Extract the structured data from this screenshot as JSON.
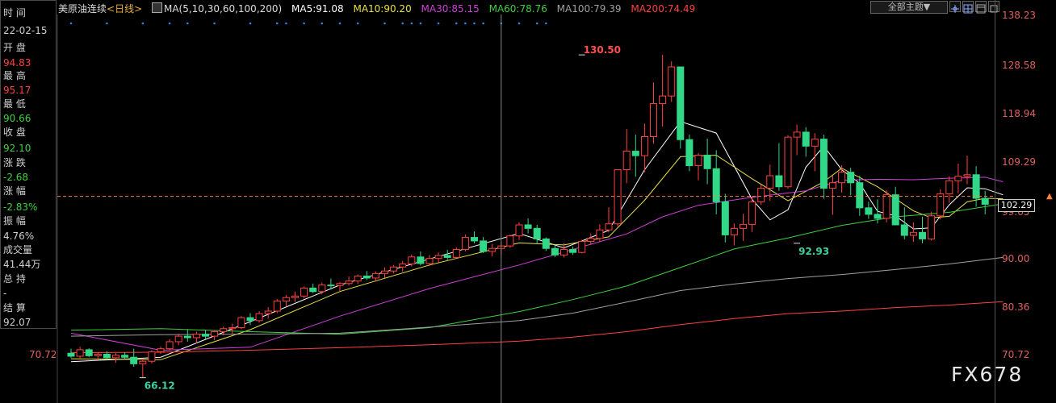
{
  "side_panel": {
    "time_label": "时 间",
    "date": "22-02-15",
    "open_label": "开 盘",
    "open": "94.83",
    "high_label": "最 高",
    "high": "95.17",
    "low_label": "最 低",
    "low": "90.66",
    "close_label": "收 盘",
    "close": "92.10",
    "change_label": "涨 跌",
    "change": "-2.68",
    "change_pct_label": "涨 幅",
    "change_pct": "-2.83%",
    "amplitude_label": "振 幅",
    "amplitude": "4.76%",
    "volume_label": "成交量",
    "volume": "41.44万",
    "open_interest_label": "总 持",
    "open_interest": "-",
    "settlement_label": "结 算",
    "settlement": "92.07"
  },
  "header": {
    "symbol": "美原油连续",
    "period": "<日线>",
    "ma_params": "MA(5,10,30,60,100,200)",
    "ma5": "MA5:91.08",
    "ma10": "MA10:90.20",
    "ma30": "MA30:85.15",
    "ma60": "MA60:78.76",
    "ma100": "MA100:79.39",
    "ma200": "MA200:74.49",
    "theme_select": "全部主题▼"
  },
  "colors": {
    "up": "#ff4040",
    "down": "#30d888",
    "ma5": "#ffffff",
    "ma10": "#e8e04a",
    "ma30": "#d040d8",
    "ma60": "#40d040",
    "ma100": "#a0a0a0",
    "ma200": "#ff4040",
    "axis_text": "#e06060"
  },
  "left_marker": "70.72",
  "current_price_box": "102.29",
  "watermark": "FX678",
  "chart_data": {
    "type": "candlestick",
    "y_axis_ticks": [
      "138.23",
      "128.58",
      "118.94",
      "109.29",
      "99.65",
      "90.00",
      "80.36",
      "70.72"
    ],
    "ylim": [
      70.72,
      138.23
    ],
    "annotations": [
      {
        "label": "130.50",
        "x_index": 57,
        "price": 130.5
      },
      {
        "label": "66.12",
        "x_index": 8,
        "price": 66.12
      },
      {
        "label": "92.93",
        "x_index": 81,
        "price": 92.93
      }
    ],
    "current_price": 102.29,
    "candles": [
      [
        71.0,
        71.9,
        70.1,
        70.4
      ],
      [
        70.4,
        72.3,
        69.9,
        71.7
      ],
      [
        71.7,
        72.0,
        70.2,
        70.5
      ],
      [
        70.5,
        71.1,
        69.6,
        70.8
      ],
      [
        70.8,
        71.4,
        69.7,
        70.1
      ],
      [
        70.1,
        71.0,
        69.1,
        70.6
      ],
      [
        70.6,
        71.2,
        69.9,
        70.2
      ],
      [
        70.2,
        71.9,
        68.3,
        68.9
      ],
      [
        68.9,
        69.9,
        66.12,
        69.4
      ],
      [
        69.4,
        71.6,
        69.0,
        71.3
      ],
      [
        71.3,
        72.3,
        70.9,
        71.9
      ],
      [
        71.9,
        73.8,
        71.5,
        73.3
      ],
      [
        73.3,
        74.9,
        72.6,
        74.4
      ],
      [
        74.4,
        75.8,
        73.3,
        74.1
      ],
      [
        74.1,
        75.3,
        73.0,
        74.8
      ],
      [
        74.8,
        75.7,
        73.8,
        74.4
      ],
      [
        74.4,
        75.6,
        73.6,
        75.3
      ],
      [
        75.3,
        76.3,
        74.6,
        75.9
      ],
      [
        75.9,
        76.9,
        74.8,
        76.1
      ],
      [
        76.1,
        78.4,
        75.8,
        78.1
      ],
      [
        78.1,
        79.0,
        76.6,
        77.5
      ],
      [
        77.5,
        79.4,
        77.1,
        78.9
      ],
      [
        78.9,
        80.2,
        77.9,
        79.4
      ],
      [
        79.4,
        81.8,
        79.0,
        81.4
      ],
      [
        81.4,
        82.6,
        80.4,
        82.1
      ],
      [
        82.1,
        83.3,
        81.2,
        82.4
      ],
      [
        82.4,
        84.3,
        81.9,
        84.0
      ],
      [
        84.0,
        84.9,
        83.0,
        83.3
      ],
      [
        83.3,
        85.1,
        82.8,
        84.6
      ],
      [
        84.6,
        85.9,
        83.7,
        84.5
      ],
      [
        84.5,
        85.2,
        83.4,
        84.9
      ],
      [
        84.9,
        86.3,
        84.5,
        85.4
      ],
      [
        85.4,
        86.7,
        84.8,
        86.4
      ],
      [
        86.4,
        87.4,
        85.6,
        86.0
      ],
      [
        86.0,
        87.3,
        85.3,
        86.9
      ],
      [
        86.9,
        88.1,
        86.0,
        87.4
      ],
      [
        87.4,
        88.6,
        86.9,
        88.2
      ],
      [
        88.2,
        89.4,
        87.3,
        88.8
      ],
      [
        88.8,
        90.7,
        88.3,
        90.2
      ],
      [
        90.2,
        91.3,
        88.5,
        88.9
      ],
      [
        88.9,
        90.6,
        88.4,
        89.9
      ],
      [
        89.9,
        91.1,
        89.1,
        90.5
      ],
      [
        90.5,
        91.6,
        89.6,
        90.1
      ],
      [
        90.1,
        92.1,
        89.9,
        91.7
      ],
      [
        91.7,
        94.7,
        91.3,
        94.1
      ],
      [
        94.1,
        95.3,
        92.9,
        93.4
      ],
      [
        93.4,
        94.2,
        91.0,
        91.3
      ],
      [
        91.3,
        92.8,
        90.3,
        91.9
      ],
      [
        91.9,
        93.1,
        90.6,
        92.4
      ],
      [
        92.4,
        94.7,
        92.0,
        94.4
      ],
      [
        94.4,
        97.1,
        93.6,
        96.6
      ],
      [
        96.6,
        97.9,
        94.9,
        95.9
      ],
      [
        95.9,
        96.6,
        92.8,
        93.8
      ],
      [
        93.8,
        94.1,
        91.4,
        91.9
      ],
      [
        91.9,
        92.7,
        90.2,
        90.6
      ],
      [
        90.6,
        92.9,
        90.1,
        91.7
      ],
      [
        91.7,
        92.3,
        90.6,
        91.1
      ],
      [
        91.1,
        93.6,
        90.9,
        93.3
      ],
      [
        93.3,
        94.9,
        92.6,
        93.9
      ],
      [
        93.9,
        96.7,
        93.2,
        95.6
      ],
      [
        95.6,
        100.1,
        95.1,
        96.8
      ],
      [
        96.8,
        104.8,
        96.3,
        107.6
      ],
      [
        107.6,
        115.7,
        104.9,
        111.3
      ],
      [
        111.3,
        114.6,
        106.2,
        110.4
      ],
      [
        110.4,
        116.8,
        107.1,
        114.2
      ],
      [
        114.2,
        125.0,
        112.8,
        120.8
      ],
      [
        120.8,
        130.5,
        116.2,
        122.3
      ],
      [
        122.3,
        129.2,
        121.1,
        128.1
      ],
      [
        128.1,
        127.6,
        111.8,
        113.6
      ],
      [
        113.6,
        114.6,
        107.3,
        108.4
      ],
      [
        108.4,
        110.9,
        105.5,
        110.5
      ],
      [
        110.5,
        113.8,
        104.7,
        107.8
      ],
      [
        107.8,
        111.5,
        98.7,
        101.2
      ],
      [
        101.2,
        102.8,
        93.1,
        94.6
      ],
      [
        94.6,
        96.9,
        92.5,
        95.9
      ],
      [
        95.9,
        98.8,
        93.4,
        96.7
      ],
      [
        96.7,
        102.3,
        95.2,
        101.2
      ],
      [
        101.2,
        104.6,
        100.6,
        103.9
      ],
      [
        103.9,
        108.6,
        101.4,
        106.4
      ],
      [
        106.4,
        112.9,
        103.4,
        104.2
      ],
      [
        104.2,
        114.5,
        103.8,
        114.1
      ],
      [
        114.1,
        116.6,
        110.5,
        115.1
      ],
      [
        115.1,
        116.1,
        110.2,
        112.3
      ],
      [
        112.3,
        114.9,
        107.3,
        113.7
      ],
      [
        113.7,
        114.6,
        101.8,
        103.9
      ],
      [
        103.9,
        106.5,
        98.6,
        105.0
      ],
      [
        105.0,
        108.5,
        103.0,
        107.1
      ],
      [
        107.1,
        108.0,
        102.5,
        105.0
      ],
      [
        105.0,
        106.4,
        98.4,
        100.0
      ],
      [
        100.0,
        101.2,
        97.8,
        98.7
      ],
      [
        98.7,
        101.7,
        96.9,
        97.9
      ],
      [
        97.9,
        103.5,
        97.1,
        102.6
      ],
      [
        102.6,
        104.2,
        97.5,
        96.6
      ],
      [
        96.6,
        100.1,
        93.7,
        94.5
      ],
      [
        94.5,
        97.1,
        93.2,
        95.1
      ],
      [
        95.1,
        98.2,
        92.93,
        93.8
      ],
      [
        93.8,
        99.2,
        93.5,
        98.4
      ],
      [
        98.4,
        103.7,
        97.7,
        102.8
      ],
      [
        102.8,
        106.3,
        101.0,
        105.4
      ],
      [
        105.4,
        108.8,
        102.9,
        106.3
      ],
      [
        106.3,
        110.4,
        104.7,
        106.6
      ],
      [
        106.6,
        108.3,
        100.2,
        101.9
      ],
      [
        101.9,
        103.4,
        98.7,
        100.7
      ]
    ],
    "indicators": {
      "ma5": {
        "name": "MA5",
        "points": [
          [
            0,
            69.3
          ],
          [
            10,
            70.2
          ],
          [
            20,
            77.3
          ],
          [
            30,
            84.6
          ],
          [
            40,
            89.8
          ],
          [
            50,
            94.9
          ],
          [
            55,
            92.0
          ],
          [
            60,
            95.5
          ],
          [
            64,
            107.6
          ],
          [
            68,
            117.2
          ],
          [
            72,
            114.9
          ],
          [
            76,
            101.7
          ],
          [
            78,
            97.6
          ],
          [
            80,
            99.6
          ],
          [
            82,
            108.1
          ],
          [
            84,
            112.3
          ],
          [
            86,
            107.6
          ],
          [
            88,
            104.9
          ],
          [
            90,
            99.3
          ],
          [
            92,
            98.4
          ],
          [
            94,
            95.8
          ],
          [
            96,
            96.0
          ],
          [
            98,
            100.6
          ],
          [
            100,
            104.0
          ],
          [
            102,
            103.8
          ],
          [
            104,
            102.6
          ]
        ]
      },
      "ma10": {
        "name": "MA10",
        "points": [
          [
            0,
            69.9
          ],
          [
            10,
            69.7
          ],
          [
            20,
            75.7
          ],
          [
            30,
            83.3
          ],
          [
            40,
            88.6
          ],
          [
            50,
            93.0
          ],
          [
            55,
            92.6
          ],
          [
            60,
            94.2
          ],
          [
            64,
            101.5
          ],
          [
            68,
            110.2
          ],
          [
            72,
            110.5
          ],
          [
            76,
            105.8
          ],
          [
            80,
            101.4
          ],
          [
            84,
            105.2
          ],
          [
            86,
            107.9
          ],
          [
            90,
            104.2
          ],
          [
            94,
            99.4
          ],
          [
            96,
            98.0
          ],
          [
            98,
            98.3
          ],
          [
            100,
            101.2
          ],
          [
            102,
            101.9
          ],
          [
            104,
            101.8
          ]
        ]
      },
      "ma30": {
        "name": "MA30",
        "points": [
          [
            0,
            75.0
          ],
          [
            10,
            71.6
          ],
          [
            20,
            72.2
          ],
          [
            30,
            78.4
          ],
          [
            40,
            83.9
          ],
          [
            50,
            88.6
          ],
          [
            56,
            91.7
          ],
          [
            62,
            94.8
          ],
          [
            66,
            98.2
          ],
          [
            70,
            100.5
          ],
          [
            76,
            102.1
          ],
          [
            82,
            103.4
          ],
          [
            86,
            105.5
          ],
          [
            90,
            105.7
          ],
          [
            94,
            105.6
          ],
          [
            98,
            105.9
          ],
          [
            102,
            106.1
          ],
          [
            104,
            105.2
          ]
        ]
      },
      "ma60": {
        "name": "MA60",
        "points": [
          [
            0,
            75.6
          ],
          [
            10,
            75.9
          ],
          [
            20,
            75.3
          ],
          [
            30,
            74.8
          ],
          [
            40,
            76.1
          ],
          [
            50,
            79.3
          ],
          [
            56,
            81.7
          ],
          [
            62,
            84.4
          ],
          [
            68,
            88.1
          ],
          [
            74,
            91.8
          ],
          [
            80,
            94.0
          ],
          [
            86,
            96.5
          ],
          [
            92,
            98.2
          ],
          [
            98,
            99.1
          ],
          [
            104,
            100.8
          ]
        ]
      },
      "ma100": {
        "name": "MA100",
        "points": [
          [
            0,
            74.4
          ],
          [
            10,
            74.7
          ],
          [
            20,
            74.8
          ],
          [
            30,
            75.0
          ],
          [
            40,
            76.2
          ],
          [
            50,
            77.5
          ],
          [
            56,
            79.0
          ],
          [
            62,
            81.2
          ],
          [
            68,
            83.5
          ],
          [
            74,
            84.8
          ],
          [
            80,
            85.9
          ],
          [
            86,
            86.7
          ],
          [
            92,
            87.7
          ],
          [
            98,
            88.8
          ],
          [
            104,
            90.1
          ]
        ]
      },
      "ma200": {
        "name": "MA200",
        "points": [
          [
            0,
            71.1
          ],
          [
            10,
            71.2
          ],
          [
            20,
            71.6
          ],
          [
            30,
            72.1
          ],
          [
            40,
            72.7
          ],
          [
            50,
            73.4
          ],
          [
            56,
            74.2
          ],
          [
            62,
            75.3
          ],
          [
            68,
            76.7
          ],
          [
            74,
            77.9
          ],
          [
            80,
            78.9
          ],
          [
            86,
            79.4
          ],
          [
            92,
            80.1
          ],
          [
            98,
            80.6
          ],
          [
            104,
            81.3
          ]
        ]
      }
    },
    "crosshair_x_index": 48,
    "dotted_marker_indices": [
      0,
      4,
      8,
      11,
      13,
      16,
      20,
      23,
      24,
      26,
      28,
      30,
      32,
      35,
      37,
      38,
      39,
      41,
      43,
      44,
      45,
      46,
      48,
      50,
      52,
      53
    ]
  }
}
